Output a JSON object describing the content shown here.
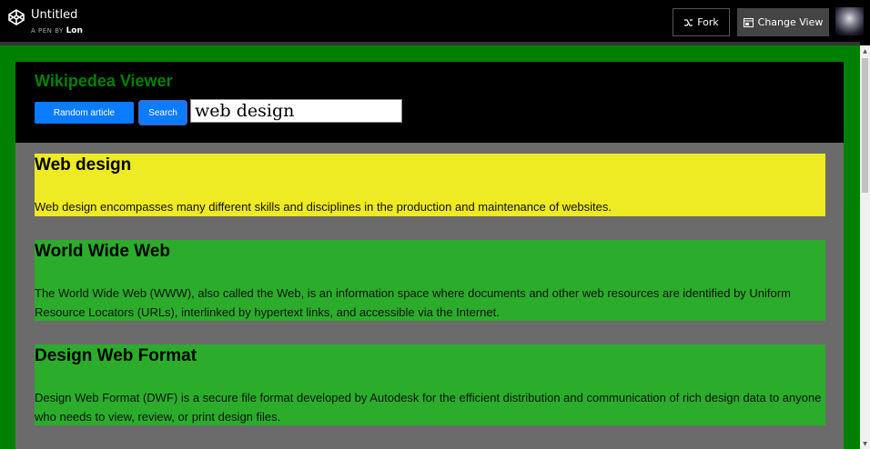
{
  "topbar": {
    "title": "Untitled",
    "byline_prefix": "A PEN BY",
    "author": "Lon",
    "fork_label": "Fork",
    "change_view_label": "Change View"
  },
  "app": {
    "title": "Wikipedea Viewer",
    "random_label": "Random article",
    "search_label": "Search",
    "search_value": "web design"
  },
  "results": [
    {
      "title": "Web design",
      "snippet": "Web design encompasses many different skills and disciplines in the production and maintenance of websites.",
      "color": "#eeea23"
    },
    {
      "title": "World Wide Web",
      "snippet": "The World Wide Web (WWW), also called the Web, is an information space where documents and other web resources are identified by Uniform Resource Locators (URLs), interlinked by hypertext links, and accessible via the Internet.",
      "color": "#2bad2b"
    },
    {
      "title": "Design Web Format",
      "snippet": "Design Web Format (DWF) is a secure file format developed by Autodesk for the efficient distribution and communication of rich design data to anyone who needs to view, review, or print design files.",
      "color": "#2bad2b"
    }
  ],
  "colors": {
    "preview_bg": "#008000",
    "title_green": "#008000",
    "button_blue": "#0b7bff",
    "results_bg": "#6b6b6b"
  },
  "icons": [
    "codepen-logo-icon",
    "fork-icon",
    "change-view-icon",
    "user-avatar"
  ]
}
